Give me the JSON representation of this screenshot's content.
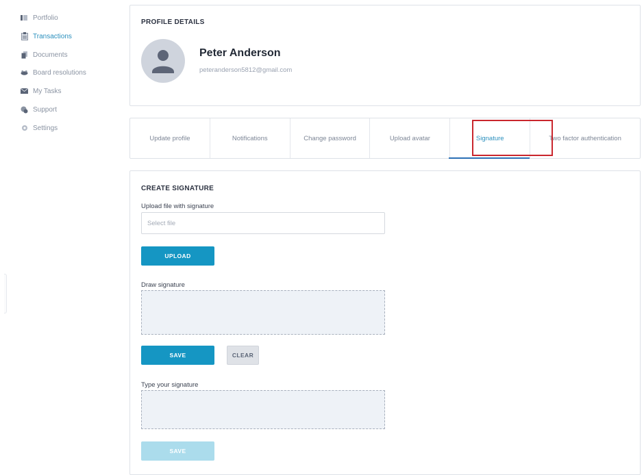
{
  "sidebar": {
    "items": [
      {
        "label": "Portfolio",
        "icon": "portfolio-icon",
        "active": false
      },
      {
        "label": "Transactions",
        "icon": "transactions-icon",
        "active": true
      },
      {
        "label": "Documents",
        "icon": "documents-icon",
        "active": false
      },
      {
        "label": "Board resolutions",
        "icon": "board-resolutions-icon",
        "active": false
      },
      {
        "label": "My Tasks",
        "icon": "tasks-icon",
        "active": false
      },
      {
        "label": "Support",
        "icon": "support-icon",
        "active": false
      },
      {
        "label": "Settings",
        "icon": "settings-icon",
        "active": false
      }
    ]
  },
  "profile": {
    "section_title": "PROFILE DETAILS",
    "name": "Peter Anderson",
    "email": "peteranderson5812@gmail.com"
  },
  "tabs": [
    {
      "label": "Update profile"
    },
    {
      "label": "Notifications"
    },
    {
      "label": "Change password"
    },
    {
      "label": "Upload avatar"
    },
    {
      "label": "Signature",
      "active": true
    },
    {
      "label": "Two factor authentication"
    }
  ],
  "signature": {
    "section_title": "CREATE SIGNATURE",
    "upload_label": "Upload file with signature",
    "file_placeholder": "Select file",
    "upload_button": "UPLOAD",
    "draw_label": "Draw signature",
    "save_button": "SAVE",
    "clear_button": "CLEAR",
    "type_label": "Type your signature",
    "save_typed_button": "SAVE"
  },
  "colors": {
    "accent": "#1596c3",
    "active_nav": "#2a8fbd",
    "highlight": "#c9252c"
  }
}
